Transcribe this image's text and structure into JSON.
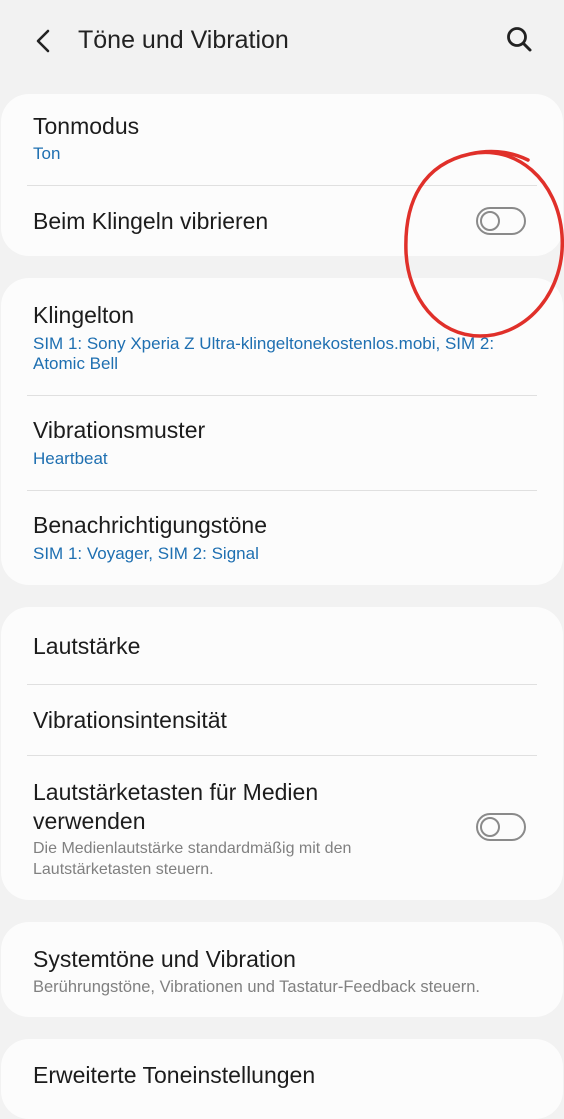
{
  "header": {
    "title": "Töne und Vibration",
    "back_icon": "chevron-left-icon",
    "search_icon": "search-icon"
  },
  "card1": {
    "tonmodus": {
      "title": "Tonmodus",
      "value": "Ton"
    },
    "beim_klingeln_vibrieren": {
      "title": "Beim Klingeln vibrieren",
      "toggle_on": false
    }
  },
  "card2": {
    "klingelton": {
      "title": "Klingelton",
      "value": "SIM 1: Sony Xperia Z Ultra-klingeltonekostenlos.mobi, SIM 2: Atomic Bell"
    },
    "vibrationsmuster": {
      "title": "Vibrationsmuster",
      "value": "Heartbeat"
    },
    "benachrichtigungstoene": {
      "title": "Benachrichtigungstöne",
      "value": "SIM 1: Voyager, SIM 2: Signal"
    }
  },
  "card3": {
    "lautstaerke": {
      "title": "Lautstärke"
    },
    "vibrationsintensitaet": {
      "title": "Vibrationsintensität"
    },
    "lautstaerketasten": {
      "title_line1": "Lautstärketasten für Medien",
      "title_line2": "verwenden",
      "description": "Die Medienlautstärke standardmäßig mit den Lautstärketasten steuern.",
      "toggle_on": false
    }
  },
  "card4": {
    "systemtoene": {
      "title": "Systemtöne und Vibration",
      "description": "Berührungstöne, Vibrationen und Tastatur-Feedback steuern."
    }
  },
  "card5": {
    "erweiterte": {
      "title": "Erweiterte Toneinstellungen"
    }
  },
  "colors": {
    "background": "#f2f2f2",
    "card": "#fcfcfc",
    "accent_blue": "#1e6fb1",
    "annotation_red": "#e0302a"
  }
}
